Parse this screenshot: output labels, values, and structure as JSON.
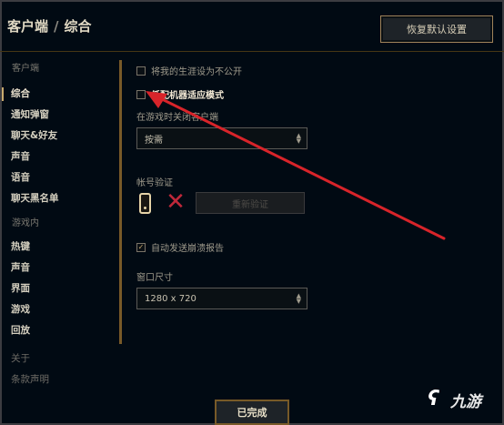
{
  "header": {
    "section": "客户端",
    "separator": "/",
    "title": "综合",
    "reset_label": "恢复默认设置"
  },
  "sidebar": {
    "client_group": "客户端",
    "client_items": [
      "综合",
      "通知弹窗",
      "聊天&好友",
      "声音",
      "语音",
      "聊天黑名单"
    ],
    "ingame_group": "游戏内",
    "ingame_items": [
      "热键",
      "声音",
      "界面",
      "游戏",
      "回放"
    ],
    "footer_items": [
      "关于",
      "条款声明"
    ]
  },
  "settings": {
    "hide_career_label": "将我的生涯设为不公开",
    "hide_career_checked": false,
    "low_spec_label": "低配机器适应模式",
    "low_spec_checked": false,
    "close_client_label": "在游戏时关闭客户端",
    "close_client_value": "按需",
    "account_verify_label": "帐号验证",
    "verify_button_label": "重新验证",
    "auto_crash_report_label": "自动发送崩溃报告",
    "auto_crash_report_checked": true,
    "window_size_label": "窗口尺寸",
    "window_size_value": "1280 x 720"
  },
  "footer": {
    "done_label": "已完成"
  },
  "watermark": {
    "text": "九游"
  },
  "colors": {
    "gold": "#c8aa6e",
    "annotation_red": "#d8242a",
    "background": "#010a13"
  }
}
